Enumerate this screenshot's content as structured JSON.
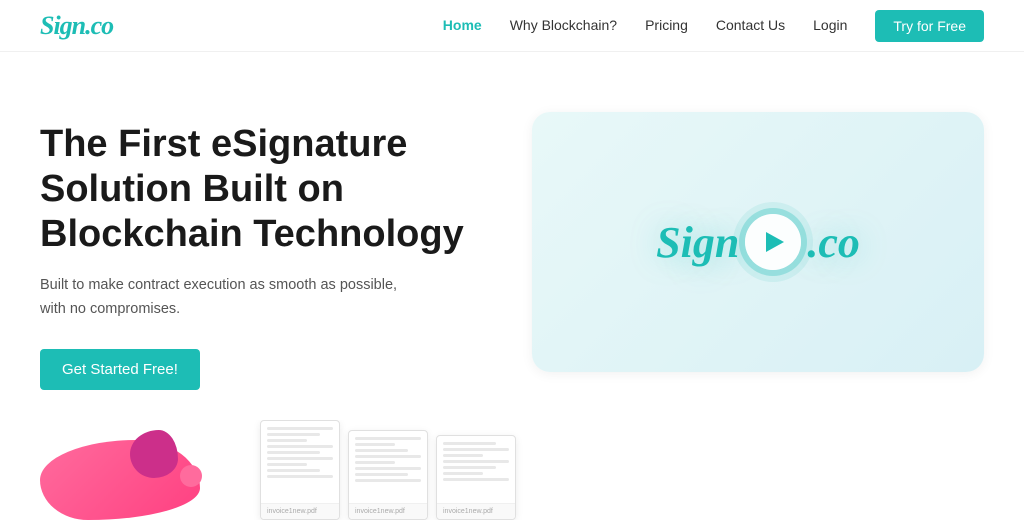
{
  "brand": {
    "logo_text": "Sign.co",
    "logo_dot": ".co"
  },
  "navbar": {
    "links": [
      {
        "label": "Home",
        "active": true
      },
      {
        "label": "Why Blockchain?",
        "active": false
      },
      {
        "label": "Pricing",
        "active": false
      },
      {
        "label": "Contact Us",
        "active": false
      },
      {
        "label": "Login",
        "active": false
      }
    ],
    "cta_label": "Try for Free"
  },
  "hero": {
    "headline_line1": "The First eSignature",
    "headline_line2": "Solution Built on",
    "headline_line3": "Blockchain Technology",
    "subtext": "Built to make contract execution as smooth as possible,\nwith no compromises.",
    "cta_label": "Get Started Free!",
    "video_logo_part1": "Sign",
    "video_logo_part2": ".co"
  },
  "docs": [
    {
      "footer": "invoice1new.pdf"
    },
    {
      "footer": "invoice1new.pdf"
    },
    {
      "footer": "invoice1new.pdf"
    }
  ]
}
